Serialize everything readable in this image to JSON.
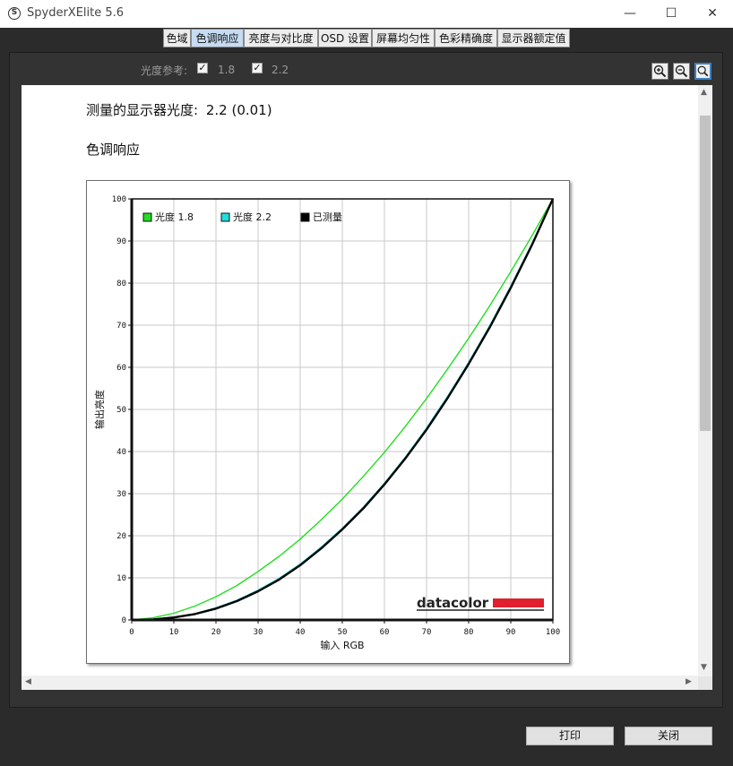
{
  "window": {
    "title": "SpyderXElite 5.6",
    "app_icon_letter": "S",
    "minimize": "—",
    "maximize": "☐",
    "close": "✕"
  },
  "tabs": [
    {
      "label": "色域",
      "active": false
    },
    {
      "label": "色调响应",
      "active": true
    },
    {
      "label": "亮度与对比度",
      "active": false
    },
    {
      "label": "OSD 设置",
      "active": false
    },
    {
      "label": "屏幕均匀性",
      "active": false
    },
    {
      "label": "色彩精确度",
      "active": false
    },
    {
      "label": "显示器额定值",
      "active": false
    }
  ],
  "toolbar": {
    "gamma_ref_label": "光度参考:",
    "gamma_18": {
      "label": "1.8",
      "checked": true
    },
    "gamma_22": {
      "label": "2.2",
      "checked": true
    },
    "zoom": [
      "zoom-in-icon",
      "zoom-out-icon",
      "zoom-fit-icon"
    ]
  },
  "report": {
    "measured_label": "测量的显示器光度:",
    "measured_value": "2.2 (0.01)",
    "section_title": "色调响应"
  },
  "chart_data": {
    "type": "line",
    "xlabel": "输入 RGB",
    "ylabel": "输出亮度",
    "xlim": [
      0,
      100
    ],
    "ylim": [
      0,
      100
    ],
    "xticks": [
      0,
      10,
      20,
      30,
      40,
      50,
      60,
      70,
      80,
      90,
      100
    ],
    "yticks": [
      0,
      10,
      20,
      30,
      40,
      50,
      60,
      70,
      80,
      90,
      100
    ],
    "grid": true,
    "legend_position": "top-left",
    "x": [
      0,
      5,
      10,
      15,
      20,
      25,
      30,
      35,
      40,
      45,
      50,
      55,
      60,
      65,
      70,
      75,
      80,
      85,
      90,
      95,
      100
    ],
    "series": [
      {
        "name": "光度 1.8",
        "color": "#22dd22",
        "values": [
          0,
          0.5,
          1.6,
          3.3,
          5.5,
          8.2,
          11.5,
          15.1,
          19.2,
          23.8,
          28.7,
          34.1,
          39.8,
          46.0,
          52.6,
          59.6,
          66.9,
          74.6,
          82.7,
          91.2,
          100
        ]
      },
      {
        "name": "光度 2.2",
        "color": "#22dddd",
        "values": [
          0,
          0.1,
          0.6,
          1.5,
          2.9,
          4.7,
          7.1,
          9.9,
          13.3,
          17.3,
          21.8,
          26.8,
          32.5,
          38.7,
          45.6,
          53.1,
          61.2,
          69.9,
          79.3,
          89.3,
          100
        ]
      },
      {
        "name": "已测量",
        "color": "#000000",
        "values": [
          0,
          0.1,
          0.6,
          1.4,
          2.7,
          4.5,
          6.8,
          9.6,
          13.0,
          17.0,
          21.5,
          26.5,
          32.2,
          38.4,
          45.2,
          52.7,
          60.8,
          69.5,
          78.9,
          89.0,
          100
        ]
      }
    ]
  },
  "brand": {
    "logo_text": "datacolor",
    "bar_color": "#e0202f"
  },
  "footer": {
    "print_label": "打印",
    "close_label": "关闭"
  }
}
